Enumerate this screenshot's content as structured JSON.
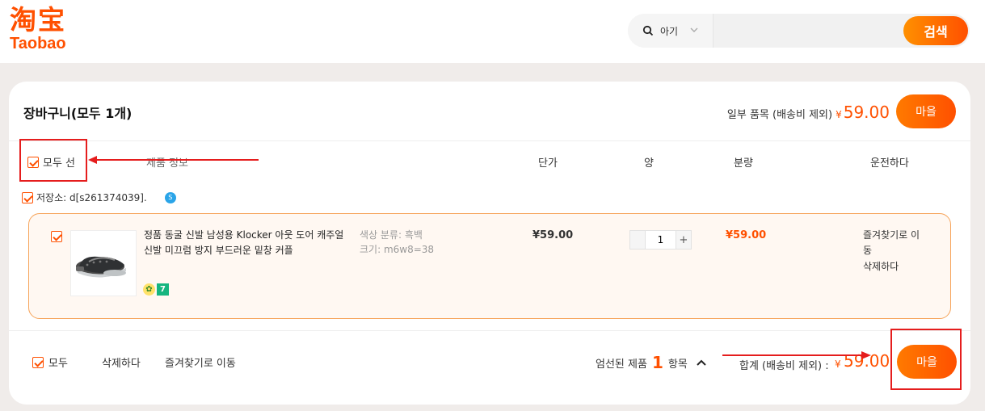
{
  "header": {
    "logo_cn": "淘宝",
    "logo_en": "Taobao",
    "search_scope": "아기",
    "search_placeholder": "",
    "search_button": "검색"
  },
  "cart": {
    "title": "장바구니(모두 1개)",
    "top_summary_label": "일부 품목 (배송비 제외)",
    "top_total_currency": "¥",
    "top_total": "59.00",
    "checkout_label": "마을",
    "columns": {
      "select_all": "모두 선",
      "info": "제품 정보",
      "unit_price": "단가",
      "quantity": "양",
      "amount": "분량",
      "operation": "운전하다"
    },
    "store": {
      "label": "저장소: d[s261374039].",
      "badge": "S"
    },
    "item": {
      "title": "정품 동굴 신발 남성용 Klocker 아웃 도어 캐주얼 신발 미끄럼 방지 부드러운 밑창 커플",
      "spec_color": "색상 분류: 흑백",
      "spec_size": "크기: m6w8=38",
      "unit_price": "¥59.00",
      "quantity": "1",
      "amount": "¥59.00",
      "op_fav": "즐겨찾기로 이동",
      "op_delete": "삭제하다",
      "badge_a": "✿",
      "badge_b": "7"
    },
    "footer": {
      "select_all": "모두",
      "delete": "삭제하다",
      "move_fav": "즐겨찾기로 이동",
      "selected_prefix": "엄선된 제품",
      "selected_count": "1",
      "selected_suffix": "항목",
      "total_label": "합계 (배송비 제외) :",
      "total_currency": "¥",
      "total": "59.00",
      "checkout_label": "마을"
    }
  },
  "colors": {
    "accent": "#ff5000",
    "annotation": "#e51d1d"
  }
}
